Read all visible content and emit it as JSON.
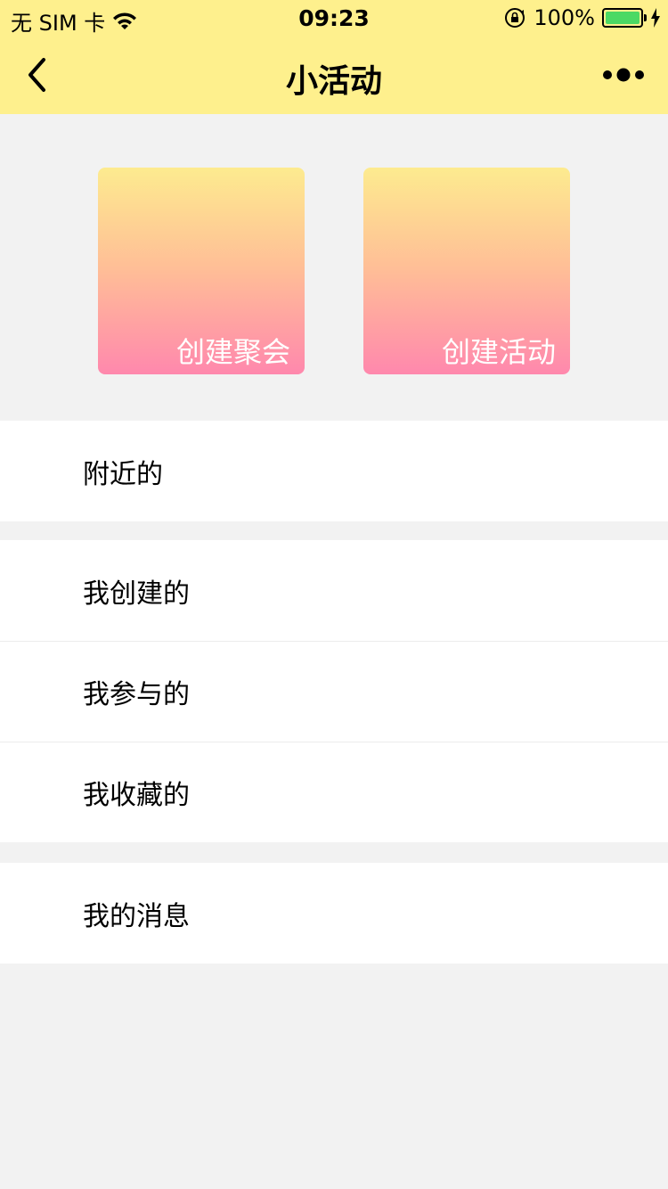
{
  "status_bar": {
    "carrier": "无 SIM 卡",
    "time": "09:23",
    "battery": "100%",
    "battery_level": 1.0,
    "icons": [
      "wifi-icon",
      "orientation-lock-icon",
      "battery-icon",
      "charging-icon"
    ]
  },
  "nav": {
    "title": "小活动",
    "back_icon": "chevron-left-icon",
    "more_icon": "more-dots-icon"
  },
  "cards": [
    {
      "label": "创建聚会"
    },
    {
      "label": "创建活动"
    }
  ],
  "menu": {
    "group1": [
      {
        "label": "附近的"
      }
    ],
    "group2": [
      {
        "label": "我创建的"
      },
      {
        "label": "我参与的"
      },
      {
        "label": "我收藏的"
      }
    ],
    "group3": [
      {
        "label": "我的消息"
      }
    ]
  },
  "colors": {
    "header_bg": "#fef08d",
    "page_bg": "#f2f2f2",
    "card_gradient_top": "#fdeb8f",
    "card_gradient_bottom": "#ff88ad",
    "battery_green": "#4cd964"
  }
}
